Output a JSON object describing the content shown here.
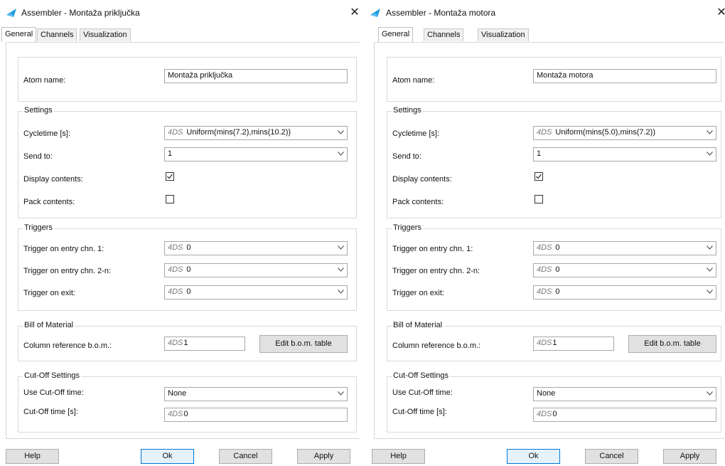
{
  "dialogs": [
    {
      "title": "Assembler - Montaža priključka",
      "tabs": [
        "General",
        "Channels",
        "Visualization"
      ],
      "atom_name_label": "Atom name:",
      "atom_name_value": "Montaža priključka",
      "settings": {
        "group_title": "Settings",
        "cycletime_label": "Cycletime [s]:",
        "cycletime_prefix": "4DS",
        "cycletime_value": "Uniform(mins(7.2),mins(10.2))",
        "send_to_label": "Send to:",
        "send_to_value": "1",
        "display_contents_label": "Display contents:",
        "display_contents_checked": true,
        "pack_contents_label": "Pack contents:",
        "pack_contents_checked": false
      },
      "triggers": {
        "group_title": "Triggers",
        "entry1_label": "Trigger on entry chn. 1:",
        "entry1_prefix": "4DS",
        "entry1_value": "0",
        "entry2_label": "Trigger on entry chn. 2-n:",
        "entry2_prefix": "4DS",
        "entry2_value": "0",
        "exit_label": "Trigger on exit:",
        "exit_prefix": "4DS",
        "exit_value": "0"
      },
      "bom": {
        "group_title": "Bill of Material",
        "column_ref_label": "Column reference b.o.m.:",
        "column_ref_prefix": "4DS",
        "column_ref_value": "1",
        "edit_button": "Edit b.o.m. table"
      },
      "cutoff": {
        "group_title": "Cut-Off Settings",
        "use_label": "Use Cut-Off time:",
        "use_value": "None",
        "time_label": "Cut-Off time [s]:",
        "time_prefix": "4DS",
        "time_value": "0"
      },
      "buttons": {
        "help": "Help",
        "ok": "Ok",
        "cancel": "Cancel",
        "apply": "Apply"
      }
    },
    {
      "title": "Assembler - Montaža motora",
      "tabs": [
        "General",
        "Channels",
        "Visualization"
      ],
      "atom_name_label": "Atom name:",
      "atom_name_value": "Montaža motora",
      "settings": {
        "group_title": "Settings",
        "cycletime_label": "Cycletime [s]:",
        "cycletime_prefix": "4DS",
        "cycletime_value": "Uniform(mins(5.0),mins(7.2))",
        "send_to_label": "Send to:",
        "send_to_value": "1",
        "display_contents_label": "Display contents:",
        "display_contents_checked": true,
        "pack_contents_label": "Pack contents:",
        "pack_contents_checked": false
      },
      "triggers": {
        "group_title": "Triggers",
        "entry1_label": "Trigger on entry chn. 1:",
        "entry1_prefix": "4DS",
        "entry1_value": "0",
        "entry2_label": "Trigger on entry chn. 2-n:",
        "entry2_prefix": "4DS",
        "entry2_value": "0",
        "exit_label": "Trigger on exit:",
        "exit_prefix": "4DS",
        "exit_value": "0"
      },
      "bom": {
        "group_title": "Bill of Material",
        "column_ref_label": "Column reference b.o.m.:",
        "column_ref_prefix": "4DS",
        "column_ref_value": "1",
        "edit_button": "Edit b.o.m. table"
      },
      "cutoff": {
        "group_title": "Cut-Off Settings",
        "use_label": "Use Cut-Off time:",
        "use_value": "None",
        "time_label": "Cut-Off time [s]:",
        "time_prefix": "4DS",
        "time_value": "0"
      },
      "buttons": {
        "help": "Help",
        "ok": "Ok",
        "cancel": "Cancel",
        "apply": "Apply"
      }
    }
  ],
  "colors": {
    "accent": "#0078d7",
    "app_icon_blue": "#1e9be0"
  },
  "icons": [
    "app-icon",
    "close-icon",
    "chevron-down-icon",
    "checkbox-checked-icon",
    "checkbox-unchecked-icon"
  ]
}
